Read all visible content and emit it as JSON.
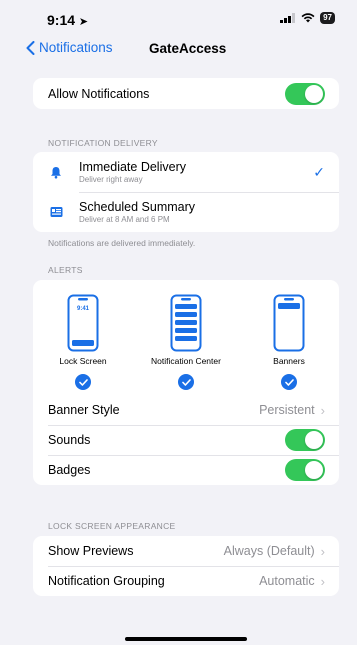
{
  "status": {
    "time": "9:14",
    "battery": "97"
  },
  "nav": {
    "back_label": "Notifications",
    "title": "GateAccess"
  },
  "allow": {
    "label": "Allow Notifications",
    "on": true
  },
  "delivery": {
    "header": "NOTIFICATION DELIVERY",
    "options": [
      {
        "title": "Immediate Delivery",
        "subtitle": "Deliver right away",
        "selected": true
      },
      {
        "title": "Scheduled Summary",
        "subtitle": "Deliver at 8 AM and 6 PM",
        "selected": false
      }
    ],
    "footnote": "Notifications are delivered immediately."
  },
  "alerts": {
    "header": "ALERTS",
    "styles": [
      {
        "label": "Lock Screen",
        "preview_time": "9:41",
        "checked": true
      },
      {
        "label": "Notification Center",
        "checked": true
      },
      {
        "label": "Banners",
        "checked": true
      }
    ],
    "banner_style": {
      "label": "Banner Style",
      "value": "Persistent"
    },
    "sounds": {
      "label": "Sounds",
      "on": true
    },
    "badges": {
      "label": "Badges",
      "on": true
    }
  },
  "lock_screen": {
    "header": "LOCK SCREEN APPEARANCE",
    "show_previews": {
      "label": "Show Previews",
      "value": "Always (Default)"
    },
    "grouping": {
      "label": "Notification Grouping",
      "value": "Automatic"
    }
  },
  "colors": {
    "accent": "#1a6fe6",
    "toggle_on": "#34c759",
    "background": "#f2f2f7"
  }
}
